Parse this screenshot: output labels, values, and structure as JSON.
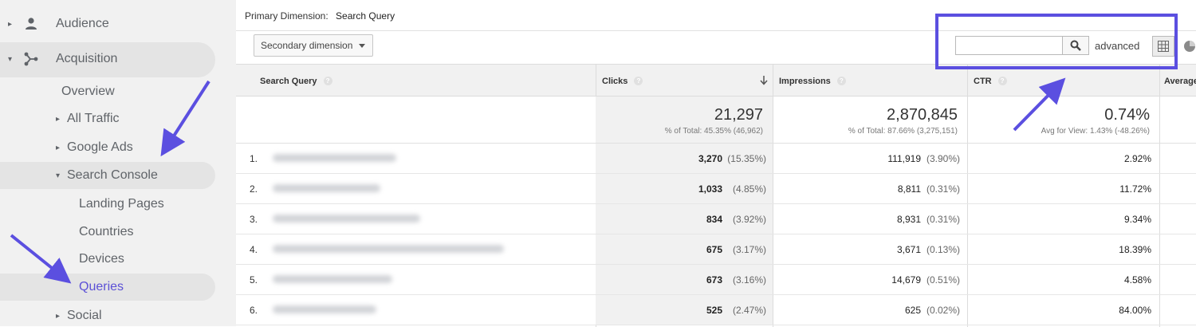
{
  "sidebar": {
    "items": [
      {
        "label": "Audience"
      },
      {
        "label": "Acquisition"
      },
      {
        "label": "Overview"
      },
      {
        "label": "All Traffic"
      },
      {
        "label": "Google Ads"
      },
      {
        "label": "Search Console"
      },
      {
        "label": "Landing Pages"
      },
      {
        "label": "Countries"
      },
      {
        "label": "Devices"
      },
      {
        "label": "Queries"
      },
      {
        "label": "Social"
      }
    ]
  },
  "primary_dimension": {
    "label": "Primary Dimension:",
    "value": "Search Query"
  },
  "toolbar": {
    "secondary_dimension": "Secondary dimension",
    "search_value": "",
    "advanced": "advanced"
  },
  "table": {
    "headers": {
      "query": "Search Query",
      "clicks": "Clicks",
      "impressions": "Impressions",
      "ctr": "CTR",
      "avg": "Average"
    },
    "totals": {
      "clicks": "21,297",
      "clicks_sub": "% of Total: 45.35% (46,962)",
      "impressions": "2,870,845",
      "impressions_sub": "% of Total: 87.66% (3,275,151)",
      "ctr": "0.74%",
      "ctr_sub": "Avg for View: 1.43% (-48.26%)"
    },
    "rows": [
      {
        "idx": "1.",
        "clicks": "3,270",
        "clicks_pct": "(15.35%)",
        "impressions": "111,919",
        "impressions_pct": "(3.90%)",
        "ctr": "2.92%"
      },
      {
        "idx": "2.",
        "clicks": "1,033",
        "clicks_pct": "(4.85%)",
        "impressions": "8,811",
        "impressions_pct": "(0.31%)",
        "ctr": "11.72%"
      },
      {
        "idx": "3.",
        "clicks": "834",
        "clicks_pct": "(3.92%)",
        "impressions": "8,931",
        "impressions_pct": "(0.31%)",
        "ctr": "9.34%"
      },
      {
        "idx": "4.",
        "clicks": "675",
        "clicks_pct": "(3.17%)",
        "impressions": "3,671",
        "impressions_pct": "(0.13%)",
        "ctr": "18.39%"
      },
      {
        "idx": "5.",
        "clicks": "673",
        "clicks_pct": "(3.16%)",
        "impressions": "14,679",
        "impressions_pct": "(0.51%)",
        "ctr": "4.58%"
      },
      {
        "idx": "6.",
        "clicks": "525",
        "clicks_pct": "(2.47%)",
        "impressions": "625",
        "impressions_pct": "(0.02%)",
        "ctr": "84.00%"
      }
    ]
  },
  "colors": {
    "accent": "#5b4fe0",
    "active_text": "#5b50d6",
    "sidebar_bg": "#f1f1f1"
  },
  "icons": [
    "person-icon",
    "acquisition-icon",
    "search-icon",
    "grid-view-icon",
    "pie-view-icon",
    "sort-down-icon",
    "help-icon"
  ]
}
